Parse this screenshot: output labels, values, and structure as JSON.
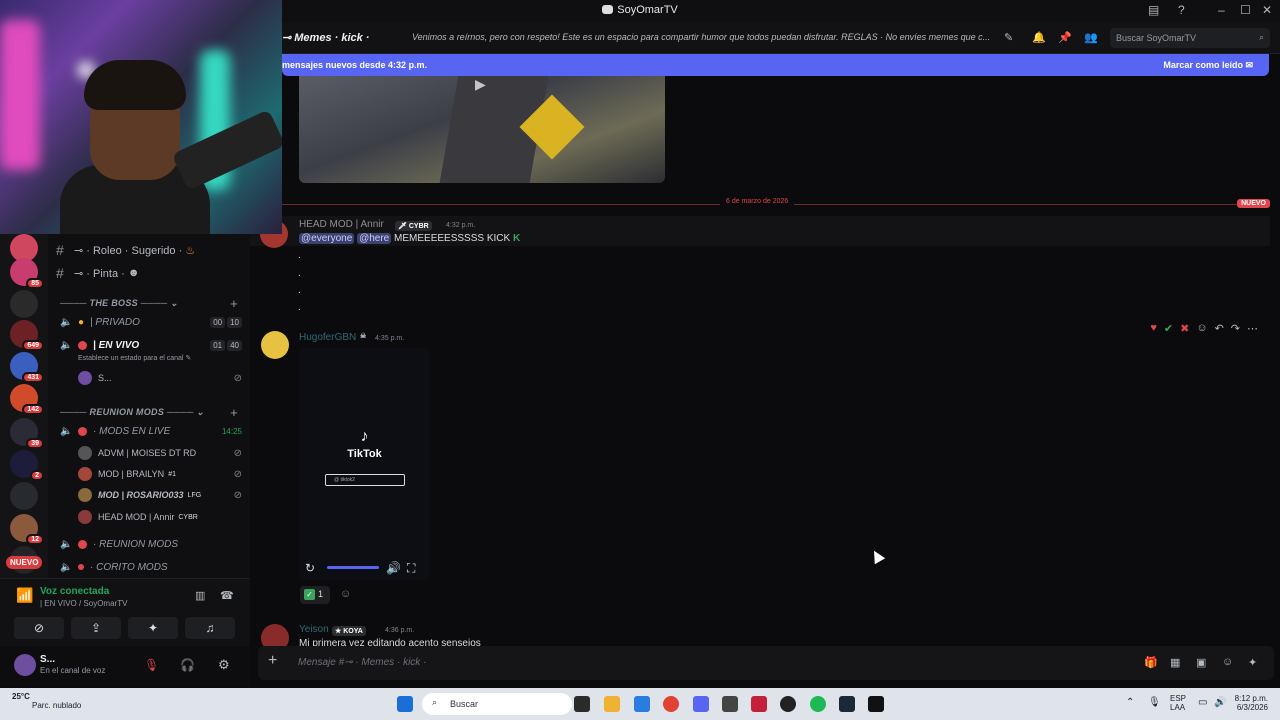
{
  "window": {
    "title": "SoyOmarTV"
  },
  "header": {
    "channel_name": "⊸ Memes · kick ·",
    "topic": "Venimos a reírnos, pero con respeto! Este es un espacio para compartir humor que todos puedan disfrutar. REGLAS · No envíes memes que c...",
    "search_placeholder": "Buscar SoyOmarTV"
  },
  "new_messages_bar": {
    "text": "mensajes nuevos desde 4:32 p.m.",
    "action": "Marcar como leído"
  },
  "server_rail": {
    "badges": [
      "85",
      "649",
      "431",
      "142",
      "39",
      "2",
      "12"
    ],
    "nuevo": "NUEVO"
  },
  "channels": {
    "text_channels": [
      {
        "name": "⊸ · Roleo · Sugerido ·"
      },
      {
        "name": "⊸ · Pinta ·"
      }
    ],
    "categories": [
      {
        "name": "THE BOSS"
      },
      {
        "name": "REUNION MODS"
      }
    ],
    "voice": [
      {
        "name": "| PRIVADO",
        "counts": [
          "00",
          "10"
        ]
      },
      {
        "name": "| EN VIVO",
        "counts": [
          "01",
          "40"
        ],
        "status": "Establece un estado para el canal"
      },
      {
        "name": "· MODS EN LIVE",
        "timer": "14:25"
      },
      {
        "name": "· REUNION MODS"
      },
      {
        "name": "· CORITO MODS"
      }
    ],
    "users_envivo": [
      {
        "name": "S..."
      }
    ],
    "users_mods": [
      {
        "name": "ADVM | MOISES DT RD",
        "tag": "RD"
      },
      {
        "name": "MOD | BRAILYN",
        "tag": "#1"
      },
      {
        "name": "MOD | ROSARIO033",
        "tag": "LFG"
      },
      {
        "name": "HEAD MOD | Annir",
        "tag": "CYBR"
      }
    ]
  },
  "voice_panel": {
    "status": "Voz conectada",
    "channel": "| EN VIVO / SoyOmarTV"
  },
  "user_panel": {
    "name": "S...",
    "status": "En el canal de voz"
  },
  "messages": {
    "date_divider": "6 de marzo de 2026",
    "nuevo_label": "NUEVO",
    "m1": {
      "author": "HEAD MOD | Annir",
      "badge": "CYBR",
      "time": "4:32 p.m.",
      "mention1": "@everyone",
      "mention2": "@here",
      "text": "MEMEEEEESSSSS KICK",
      "dots": [
        ".",
        ".",
        ".",
        "."
      ]
    },
    "m2": {
      "author": "HugoferGBN",
      "time": "4:35 p.m.",
      "video_label": "TikTok",
      "video_handle": "@ tiktok2",
      "reaction_count": "1"
    },
    "m3": {
      "author": "Yeison",
      "badge": "KOYA",
      "time": "4:36 p.m.",
      "text": "Mi primera vez editando acento sensejos"
    }
  },
  "composer": {
    "placeholder": "Mensaje #⊸ · Memes · kick ·"
  },
  "taskbar": {
    "temp": "25°C",
    "weather": "Parc. nublado",
    "search": "Buscar",
    "lang1": "ESP",
    "lang2": "LAA",
    "time": "8:12 p.m.",
    "date": "6/3/2026"
  }
}
